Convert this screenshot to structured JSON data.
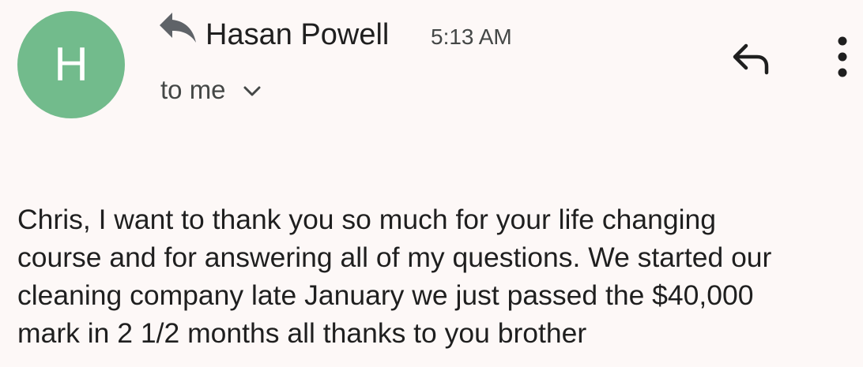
{
  "email": {
    "avatar_letter": "H",
    "avatar_color": "#72bb8c",
    "sender_name": "Hasan Powell",
    "time": "5:13 AM",
    "recipient_label": "to me",
    "replied_indicator_icon": "reply-arrow-icon",
    "actions": {
      "reply_icon": "reply-icon",
      "more_icon": "more-vert-icon"
    },
    "body_lines": [
      "Chris, I want to thank you so much for your life changing",
      "course and for answering all of my questions. We started our",
      "cleaning company late January we just passed the $40,000",
      "mark in 2 1/2 months all thanks to you brother"
    ]
  },
  "colors": {
    "background": "#fdf8f7",
    "text_primary": "#1f1f1f",
    "text_secondary": "#444746"
  }
}
